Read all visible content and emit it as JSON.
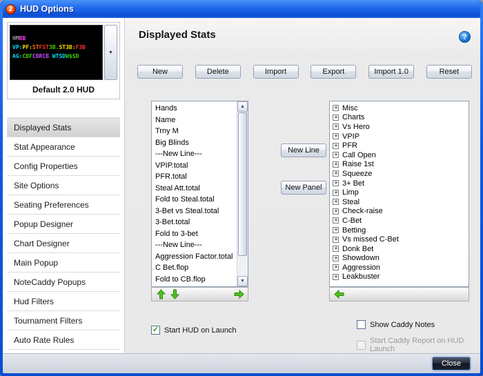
{
  "window": {
    "title": "HUD Options",
    "icon_text": "2"
  },
  "sidebar": {
    "preview": {
      "line1": [
        {
          "text": "HM",
          "color": "#9a9a9a"
        },
        {
          "text": "BB",
          "color": "#ff3df0"
        }
      ],
      "line2": [
        {
          "text": "VP:",
          "color": "#00e0ff"
        },
        {
          "text": "PF:",
          "color": "#ffe100"
        },
        {
          "text": "ST",
          "color": "#ff7a00"
        },
        {
          "text": "FST",
          "color": "#ff3030"
        },
        {
          "text": "3B.",
          "color": "#3fd400"
        },
        {
          "text": "ST3B:",
          "color": "#ffe100"
        },
        {
          "text": "F3B",
          "color": "#ff3030"
        }
      ],
      "line3": [
        {
          "text": "AG:",
          "color": "#00e0ff"
        },
        {
          "text": "CBF",
          "color": "#3fd400"
        },
        {
          "text": "CBRCB",
          "color": "#c44dff"
        },
        {
          "text": " WTSD",
          "color": "#00e0ff"
        },
        {
          "text": "W$SD",
          "color": "#3fd400"
        }
      ],
      "label": "Default 2.0 HUD"
    },
    "items": [
      {
        "label": "Displayed Stats",
        "selected": true
      },
      {
        "label": "Stat Appearance"
      },
      {
        "label": "Config Properties"
      },
      {
        "label": "Site Options"
      },
      {
        "label": "Seating Preferences"
      },
      {
        "label": "Popup Designer"
      },
      {
        "label": "Chart Designer"
      },
      {
        "label": "Main Popup"
      },
      {
        "label": "NoteCaddy Popups"
      },
      {
        "label": "Hud Filters"
      },
      {
        "label": "Tournament Filters"
      },
      {
        "label": "Auto Rate Rules"
      }
    ]
  },
  "main": {
    "title": "Displayed Stats",
    "help_icon": "?",
    "toolbar": [
      "New",
      "Delete",
      "Import",
      "Export",
      "Import 1.0",
      "Reset"
    ],
    "selected_stats": [
      "Hands",
      "Name",
      "Trny M",
      "Big Blinds",
      "---New Line---",
      "VPIP.total",
      "PFR.total",
      "Steal Att.total",
      "Fold to Steal.total",
      "3-Bet vs Steal.total",
      "3-Bet.total",
      "Fold to 3-bet",
      "---New Line---",
      "Aggression Factor.total",
      "C Bet.flop",
      "Fold to CB.flop"
    ],
    "middle_buttons": {
      "new_line": "New Line",
      "new_panel": "New Panel"
    },
    "stat_categories": [
      "Misc",
      "Charts",
      "Vs Hero",
      "VPIP",
      "PFR",
      "Call Open",
      "Raise 1st",
      "Squeeze",
      "3+ Bet",
      "Limp",
      "Steal",
      "Check-raise",
      "C-Bet",
      "Betting",
      "Vs missed C-Bet",
      "Donk Bet",
      "Showdown",
      "Aggression",
      "Leakbuster"
    ],
    "checkboxes": {
      "start_hud": {
        "label": "Start HUD on Launch",
        "mark": "✓"
      },
      "show_caddy": {
        "label": "Show Caddy Notes",
        "mark": ""
      },
      "caddy_report": {
        "label": "Start Caddy Report on HUD Launch",
        "mark": ""
      }
    }
  },
  "footer": {
    "close_label": "Close"
  }
}
